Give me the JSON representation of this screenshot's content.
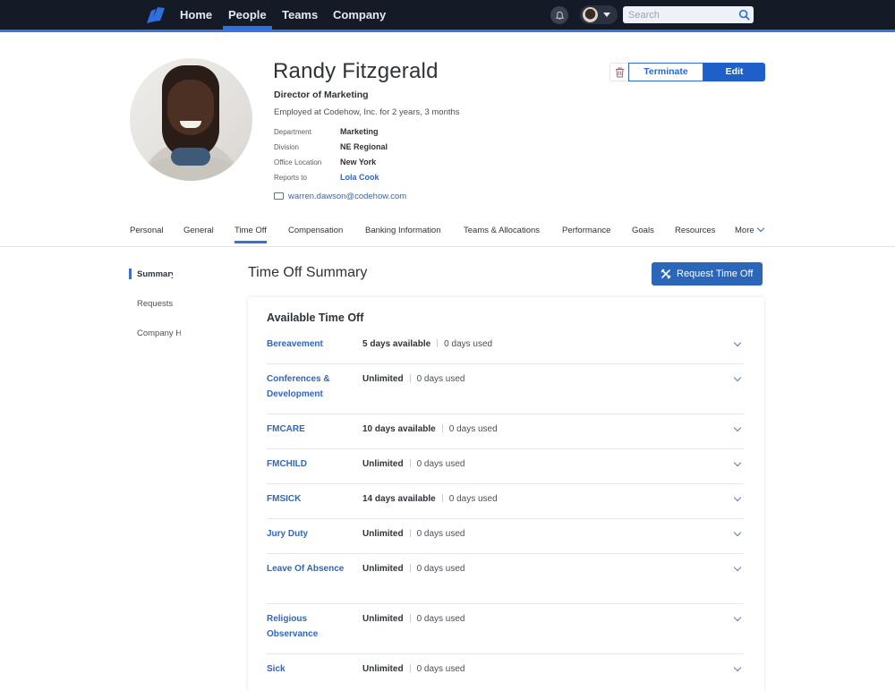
{
  "topnav": {
    "items": [
      {
        "label": "Home",
        "active": false
      },
      {
        "label": "People",
        "active": true
      },
      {
        "label": "Teams",
        "active": false
      },
      {
        "label": "Company",
        "active": false
      }
    ],
    "search_placeholder": "Search",
    "icons": {
      "logo": "brand-logo-icon",
      "bell": "bell-icon",
      "search": "search-icon",
      "caret": "caret-down-icon"
    },
    "accent_color": "#3b73d6",
    "bar_color": "#141b27"
  },
  "profile": {
    "name": "Randy Fitzgerald",
    "title": "Director of Marketing",
    "tenure": "Employed at Codehow, Inc. for 2 years, 3 months",
    "details": [
      {
        "label": "Department",
        "value": "Marketing",
        "link": false
      },
      {
        "label": "Division",
        "value": "NE Regional",
        "link": false
      },
      {
        "label": "Office Location",
        "value": "New York",
        "link": false
      },
      {
        "label": "Reports to",
        "value": "Lola Cook",
        "link": true
      }
    ],
    "email": "warren.dawson@codehow.com"
  },
  "actions": {
    "terminate_label": "Terminate",
    "edit_label": "Edit",
    "delete_icon": "trash-icon"
  },
  "tabs": [
    {
      "label": "Personal",
      "active": false
    },
    {
      "label": "General",
      "active": false
    },
    {
      "label": "Time Off",
      "active": true
    },
    {
      "label": "Compensation",
      "active": false
    },
    {
      "label": "Banking Information",
      "active": false
    },
    {
      "label": "Teams & Allocations",
      "active": false
    },
    {
      "label": "Performance",
      "active": false
    },
    {
      "label": "Goals",
      "active": false
    },
    {
      "label": "Resources",
      "active": false
    },
    {
      "label": "More",
      "active": false
    }
  ],
  "sidebar": {
    "items": [
      {
        "label": "Summary",
        "active": true
      },
      {
        "label": "Requests",
        "active": false
      },
      {
        "label": "Company Holidays",
        "active": false
      }
    ]
  },
  "main": {
    "title": "Time Off Summary",
    "request_button": "Request Time Off",
    "card_title": "Available Time Off",
    "rows": [
      {
        "name": "Bereavement",
        "available": "5 days available",
        "used": "0 days used"
      },
      {
        "name": "Conferences & Development",
        "available": "Unlimited",
        "used": "0 days used"
      },
      {
        "name": "FMCARE",
        "available": "10 days available",
        "used": "0 days used"
      },
      {
        "name": "FMCHILD",
        "available": "Unlimited",
        "used": "0 days used"
      },
      {
        "name": "FMSICK",
        "available": "14 days available",
        "used": "0 days used"
      },
      {
        "name": "Jury Duty",
        "available": "Unlimited",
        "used": "0 days used"
      },
      {
        "name": "Leave Of Absence",
        "available": "Unlimited",
        "used": "0 days used"
      },
      {
        "name": "Religious Observance",
        "available": "Unlimited",
        "used": "0 days used"
      },
      {
        "name": "Sick",
        "available": "Unlimited",
        "used": "0 days used"
      }
    ]
  }
}
